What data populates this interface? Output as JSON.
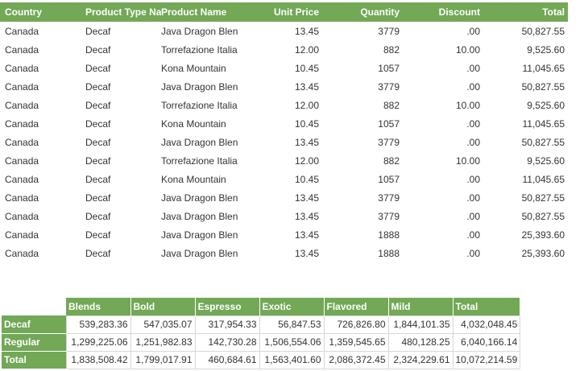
{
  "detail": {
    "headers": [
      "Country",
      "Product Type Na",
      "Product Name",
      "Unit Price",
      "Quantity",
      "Discount",
      "Total"
    ],
    "rows": [
      [
        "Canada",
        "Decaf",
        "Java Dragon Blen",
        "13.45",
        "3779",
        ".00",
        "50,827.55"
      ],
      [
        "Canada",
        "Decaf",
        "Torrefazione Italia",
        "12.00",
        "882",
        "10.00",
        "9,525.60"
      ],
      [
        "Canada",
        "Decaf",
        "Kona Mountain",
        "10.45",
        "1057",
        ".00",
        "11,045.65"
      ],
      [
        "Canada",
        "Decaf",
        "Java Dragon Blen",
        "13.45",
        "3779",
        ".00",
        "50,827.55"
      ],
      [
        "Canada",
        "Decaf",
        "Torrefazione Italia",
        "12.00",
        "882",
        "10.00",
        "9,525.60"
      ],
      [
        "Canada",
        "Decaf",
        "Kona Mountain",
        "10.45",
        "1057",
        ".00",
        "11,045.65"
      ],
      [
        "Canada",
        "Decaf",
        "Java Dragon Blen",
        "13.45",
        "3779",
        ".00",
        "50,827.55"
      ],
      [
        "Canada",
        "Decaf",
        "Torrefazione Italia",
        "12.00",
        "882",
        "10.00",
        "9,525.60"
      ],
      [
        "Canada",
        "Decaf",
        "Kona Mountain",
        "10.45",
        "1057",
        ".00",
        "11,045.65"
      ],
      [
        "Canada",
        "Decaf",
        "Java Dragon Blen",
        "13.45",
        "3779",
        ".00",
        "50,827.55"
      ],
      [
        "Canada",
        "Decaf",
        "Java Dragon Blen",
        "13.45",
        "3779",
        ".00",
        "50,827.55"
      ],
      [
        "Canada",
        "Decaf",
        "Java Dragon Blen",
        "13.45",
        "1888",
        ".00",
        "25,393.60"
      ],
      [
        "Canada",
        "Decaf",
        "Java Dragon Blen",
        "13.45",
        "1888",
        ".00",
        "25,393.60"
      ]
    ]
  },
  "crosstab": {
    "columns": [
      "Blends",
      "Bold",
      "Espresso",
      "Exotic",
      "Flavored",
      "Mild",
      "Total"
    ],
    "rows": [
      {
        "label": "Decaf",
        "values": [
          "539,283.36",
          "547,035.07",
          "317,954.33",
          "56,847.53",
          "726,826.80",
          "1,844,101.35",
          "4,032,048.45"
        ]
      },
      {
        "label": "Regular",
        "values": [
          "1,299,225.06",
          "1,251,982.83",
          "142,730.28",
          "1,506,554.06",
          "1,359,545.65",
          "480,128.25",
          "6,040,166.14"
        ]
      },
      {
        "label": "Total",
        "values": [
          "1,838,508.42",
          "1,799,017.91",
          "460,684.61",
          "1,563,401.60",
          "2,086,372.45",
          "2,324,229.61",
          "10,072,214.59"
        ]
      }
    ]
  },
  "colors": {
    "header_bg": "#72a856",
    "header_text": "#ffffff",
    "body_text": "#333333",
    "grid_line": "#d7d7d7"
  }
}
